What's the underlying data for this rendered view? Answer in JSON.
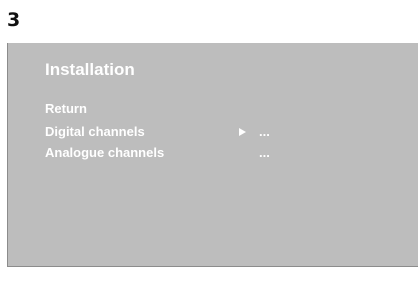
{
  "step_number": "3",
  "menu": {
    "title": "Installation",
    "items": [
      {
        "label": "Return",
        "value": ""
      },
      {
        "label": "Digital channels",
        "value": "..."
      },
      {
        "label": "Analogue channels",
        "value": "..."
      }
    ],
    "selected_arrow_icon": "triangle-right-icon"
  },
  "colors": {
    "screen_background": "#bdbdbd",
    "menu_text": "#ffffff"
  }
}
